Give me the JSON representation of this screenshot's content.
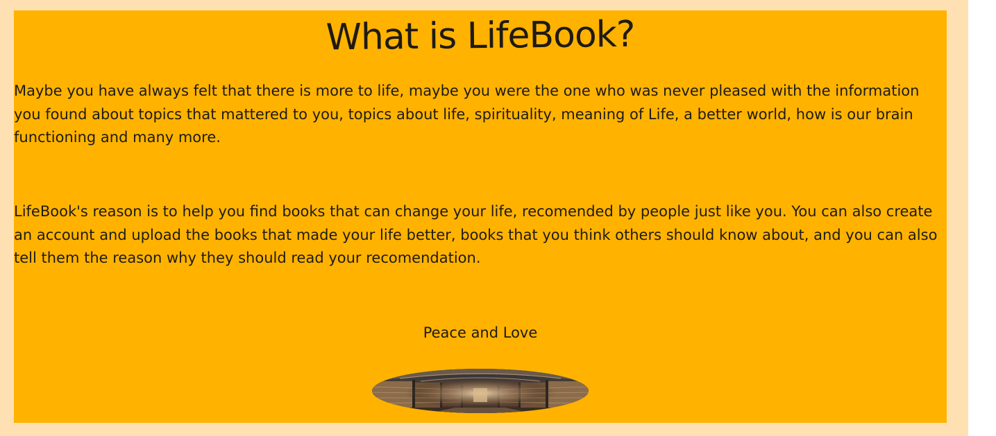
{
  "page": {
    "title": "What is LifeBook?",
    "paragraph_1": "Maybe you have always felt that there is more to life, maybe you were the one who was never pleased with the information you found about topics that mattered to you, topics about life, spirituality, meaning of Life, a better world, how is our brain functioning and many more.",
    "paragraph_2": "LifeBook's reason is to help you find books that can change your life, recomended by people just like you. You can also create an account and upload the books that made your life better, books that you think others should know about, and you can also tell them the reason why they should read your recomendation.",
    "signoff": "Peace and Love",
    "image_icon": "library-hall-image"
  },
  "colors": {
    "outer_background": "#ffe0b3",
    "card_background": "#ffb300",
    "text": "#1f1a14"
  }
}
